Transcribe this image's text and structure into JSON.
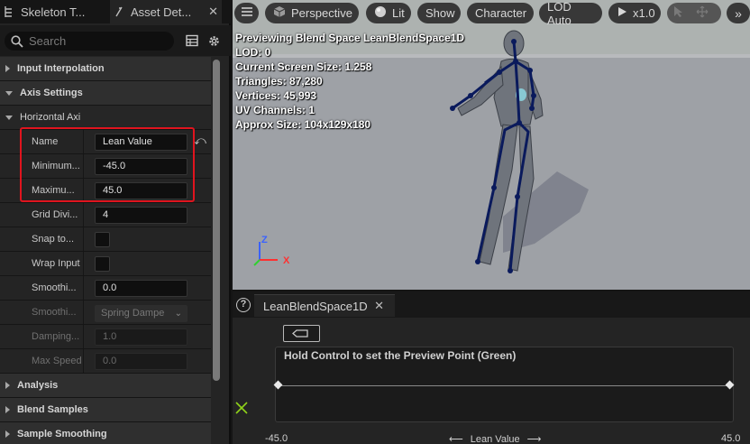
{
  "tabs": {
    "skeleton": "Skeleton T...",
    "asset_details": "Asset Det..."
  },
  "search": {
    "placeholder": "Search"
  },
  "categories": {
    "input_interpolation": "Input Interpolation",
    "axis_settings": "Axis Settings",
    "horizontal_axis": "Horizontal Axi",
    "analysis": "Analysis",
    "blend_samples": "Blend Samples",
    "sample_smoothing": "Sample Smoothing"
  },
  "properties": {
    "name": {
      "label": "Name",
      "value": "Lean Value"
    },
    "minimum": {
      "label": "Minimum...",
      "value": "-45.0"
    },
    "maximum": {
      "label": "Maximu...",
      "value": "45.0"
    },
    "grid_divisions": {
      "label": "Grid Divi...",
      "value": "4"
    },
    "snap_to_grid": {
      "label": "Snap to..."
    },
    "wrap_input": {
      "label": "Wrap Input"
    },
    "smoothing_time": {
      "label": "Smoothi...",
      "value": "0.0"
    },
    "smoothing_type": {
      "label": "Smoothi...",
      "value": "Spring Dampe"
    },
    "damping_ratio": {
      "label": "Damping...",
      "value": "1.0"
    },
    "max_speed": {
      "label": "Max Speed",
      "value": "0.0"
    }
  },
  "viewport": {
    "toolbar": {
      "perspective": "Perspective",
      "lit": "Lit",
      "show": "Show",
      "character": "Character",
      "lod": "LOD Auto",
      "speed": "x1.0"
    },
    "info_lines": [
      "Previewing Blend Space LeanBlendSpace1D",
      "LOD: 0",
      "Current Screen Size: 1.258",
      "Triangles: 87,280",
      "Vertices: 45,993",
      "UV Channels: 1",
      "Approx Size: 104x129x180"
    ],
    "axis_z": "Z",
    "axis_x": "X"
  },
  "blend_space": {
    "tab_label": "LeanBlendSpace1D",
    "help": "?",
    "message": "Hold Control to set the Preview Point (Green)",
    "min_label": "-45.0",
    "axis_label": "Lean Value",
    "max_label": "45.0"
  },
  "colors": {
    "highlight_box": "#e0141e",
    "preview_point": "#8fd21a",
    "skeleton": "#0a1a5c"
  }
}
